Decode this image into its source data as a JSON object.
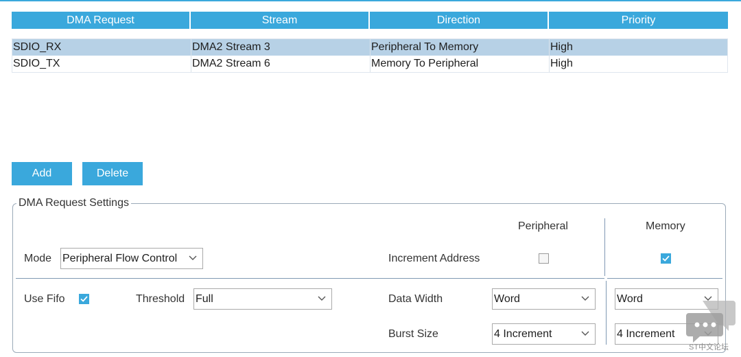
{
  "table": {
    "headers": [
      "DMA Request",
      "Stream",
      "Direction",
      "Priority"
    ],
    "rows": [
      {
        "request": "SDIO_RX",
        "stream": "DMA2 Stream 3",
        "direction": "Peripheral To Memory",
        "priority": "High",
        "selected": true
      },
      {
        "request": "SDIO_TX",
        "stream": "DMA2 Stream 6",
        "direction": "Memory To Peripheral",
        "priority": "High",
        "selected": false
      }
    ]
  },
  "buttons": {
    "add": "Add",
    "delete": "Delete"
  },
  "settings": {
    "legend": "DMA Request Settings",
    "peripheral_header": "Peripheral",
    "memory_header": "Memory",
    "mode_label": "Mode",
    "mode_value": "Peripheral Flow Control",
    "increment_address_label": "Increment Address",
    "increment_peripheral": false,
    "increment_memory": true,
    "use_fifo_label": "Use Fifo",
    "use_fifo": true,
    "threshold_label": "Threshold",
    "threshold_value": "Full",
    "data_width_label": "Data Width",
    "data_width_peripheral": "Word",
    "data_width_memory": "Word",
    "burst_size_label": "Burst Size",
    "burst_size_peripheral": "4 Increment",
    "burst_size_memory": "4 Increment"
  },
  "watermark": {
    "text": "ST中文论坛"
  },
  "colors": {
    "accent": "#3aa8dc",
    "selected_row": "#b7d1e6",
    "divider": "#7f98b3"
  }
}
